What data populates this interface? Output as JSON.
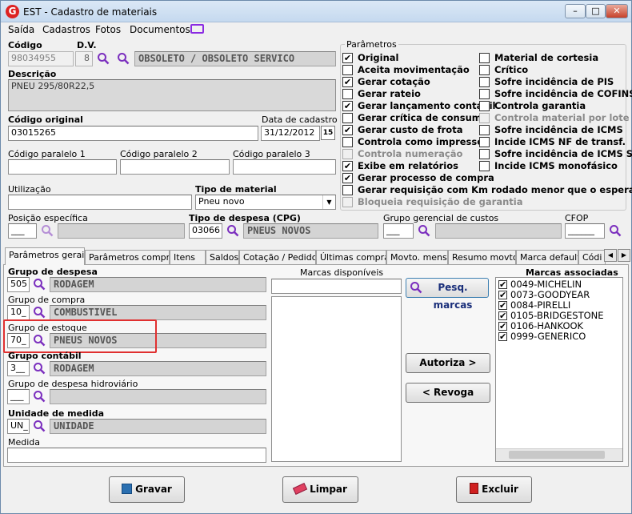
{
  "window": {
    "title": "EST - Cadastro de materiais",
    "app_icon": "G",
    "btn_min": "–",
    "btn_max": "□",
    "btn_close": "✕"
  },
  "menu": [
    {
      "label": "Saída"
    },
    {
      "label": "Cadastros"
    },
    {
      "label": "Fotos"
    },
    {
      "label": "Documentos"
    }
  ],
  "codigo": {
    "label": "Código",
    "value": "98034955"
  },
  "dv": {
    "label": "D.V.",
    "value": "8"
  },
  "situacao": "OBSOLETO / OBSOLETO SERVICO",
  "descricao": {
    "label": "Descrição",
    "value": "PNEU 295/80R22,5"
  },
  "codigo_original": {
    "label": "Código original",
    "value": "03015265"
  },
  "data_cadastro": {
    "label": "Data de cadastro",
    "value": "31/12/2012",
    "cal": "15"
  },
  "codigo_paralelo": [
    "Código paralelo 1",
    "Código paralelo 2",
    "Código paralelo 3"
  ],
  "utilizacao": {
    "label": "Utilização",
    "value": ""
  },
  "tipo_material": {
    "label": "Tipo de material",
    "value": "Pneu novo"
  },
  "posicao": {
    "label": "Posição específica",
    "value": "___"
  },
  "tipo_despesa": {
    "label": "Tipo de despesa (CPG)",
    "code": "03066",
    "desc": "PNEUS NOVOS"
  },
  "grupo_gerencial": {
    "label": "Grupo gerencial de custos",
    "value": "___"
  },
  "cfop": {
    "label": "CFOP",
    "value": "______"
  },
  "parametros": {
    "title": "Parâmetros",
    "left": [
      {
        "label": "Original",
        "checked": true,
        "disabled": false
      },
      {
        "label": "Aceita movimentação",
        "checked": false,
        "disabled": false
      },
      {
        "label": "Gerar cotação",
        "checked": true,
        "disabled": false
      },
      {
        "label": "Gerar rateio",
        "checked": false,
        "disabled": false
      },
      {
        "label": "Gerar lançamento contábil",
        "checked": true,
        "disabled": false
      },
      {
        "label": "Gerar crítica de consumo",
        "checked": false,
        "disabled": false
      },
      {
        "label": "Gerar custo de frota",
        "checked": true,
        "disabled": false
      },
      {
        "label": "Controla como impresso",
        "checked": false,
        "disabled": false
      },
      {
        "label": "Controla numeração",
        "checked": false,
        "disabled": true
      },
      {
        "label": "Exibe em relatórios",
        "checked": true,
        "disabled": false
      },
      {
        "label": "Gerar processo de compra",
        "checked": true,
        "disabled": false
      },
      {
        "label": "Gerar requisição com Km rodado menor que o esperado",
        "checked": false,
        "disabled": false
      },
      {
        "label": "Bloqueia requisição de garantia",
        "checked": false,
        "disabled": true
      }
    ],
    "right": [
      {
        "label": "Material de cortesia",
        "checked": false,
        "disabled": false
      },
      {
        "label": "Crítico",
        "checked": false,
        "disabled": false
      },
      {
        "label": "Sofre incidência de PIS",
        "checked": false,
        "disabled": false
      },
      {
        "label": "Sofre incidência de COFINS",
        "checked": false,
        "disabled": false
      },
      {
        "label": "Controla garantia",
        "checked": false,
        "disabled": false
      },
      {
        "label": "Controla material por lote",
        "checked": false,
        "disabled": true
      },
      {
        "label": "Sofre incidência de ICMS",
        "checked": false,
        "disabled": false
      },
      {
        "label": "Incide ICMS NF de transf.",
        "checked": false,
        "disabled": false
      },
      {
        "label": "Sofre incidência de ICMS ST",
        "checked": false,
        "disabled": false
      },
      {
        "label": "Incide ICMS monofásico",
        "checked": false,
        "disabled": false
      }
    ]
  },
  "tabs": [
    "Parâmetros gerais",
    "Parâmetros compras",
    "Itens",
    "Saldos",
    "Cotação / Pedido",
    "Últimas compras",
    "Movto. mensal",
    "Resumo movto.",
    "Marca default",
    "Códi"
  ],
  "tab_scroll": {
    "left": "◀",
    "right": "▶"
  },
  "gerais": {
    "grupo_despesa": {
      "label": "Grupo de despesa",
      "code": "505",
      "desc": "RODAGEM"
    },
    "grupo_compra": {
      "label": "Grupo de compra",
      "code": "10_",
      "desc": "COMBUSTIVEL"
    },
    "grupo_estoque": {
      "label": "Grupo de estoque",
      "code": "70_",
      "desc": "PNEUS NOVOS"
    },
    "grupo_contabil": {
      "label": "Grupo contábil",
      "code": "3__",
      "desc": "RODAGEM"
    },
    "grupo_hidro": {
      "label": "Grupo de despesa hidroviário",
      "code": "___",
      "desc": ""
    },
    "unidade": {
      "label": "Unidade de medida",
      "code": "UN_",
      "desc": "UNIDADE"
    },
    "medida": {
      "label": "Medida",
      "value": ""
    }
  },
  "marcas_disponiveis": {
    "label": "Marcas disponíveis"
  },
  "pesq_marcas": "Pesq. marcas",
  "autoriza": "Autoriza >",
  "revoga": "< Revoga",
  "marcas_associadas": {
    "label": "Marcas associadas",
    "items": [
      "0049-MICHELIN",
      "0073-GOODYEAR",
      "0084-PIRELLI",
      "0105-BRIDGESTONE",
      "0106-HANKOOK",
      "0999-GENERICO"
    ]
  },
  "buttons": {
    "gravar": "Gravar",
    "limpar": "Limpar",
    "excluir": "Excluir"
  },
  "highlight_color": "#e03030"
}
